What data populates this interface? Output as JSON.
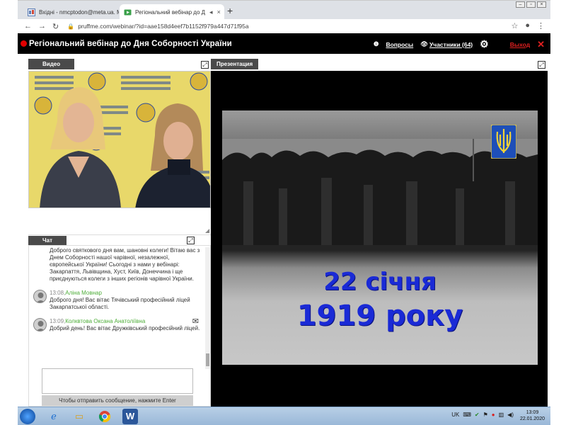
{
  "browser": {
    "tabs": [
      {
        "label": "Вхідні - nmcptodon@meta.ua. M",
        "active": false
      },
      {
        "label": "Регіональний вебінар до Д",
        "active": true
      }
    ],
    "window_controls": [
      "minimize",
      "restore",
      "close"
    ],
    "url": "pruffme.com/webinar/?id=aae158d4eef7b1152f979a447d71f95a"
  },
  "webinar": {
    "title": "Регіональний вебінар до Дня Соборності України",
    "questions_label": "Вопросы",
    "participants_label": "Участники (64)",
    "exit_label": "Выход",
    "accent_color": "#e02020"
  },
  "video": {
    "tab_label": "Видео"
  },
  "presentation": {
    "tab_label": "Презентация",
    "slide_line1": "22 січня",
    "slide_line2": "1919 року",
    "slide_text_color": "#1a2ad6"
  },
  "chat": {
    "tab_label": "Чат",
    "intro_text": "Доброго святкового дня вам, шановні колеги! Вітаю вас з Днем Соборності нашої чарівної, незалежної, європейської України! Сьогодні з нами у вебінарі: Закарпаття, Львівщина, Хуст, Київ, Донеччина і ще приєднуються колеги з інших регіонів чарівної України.",
    "messages": [
      {
        "time": "13:08,",
        "author": "Аліна Мовнар",
        "text": "Доброго дня! Вас вітає Тячівський професійний ліцей Закарпатської області."
      },
      {
        "time": "13:09,",
        "author": "Колквтова Оксана Анатоліївна",
        "text": "Добрий день! Вас вітає Дружківський професійний ліцей."
      }
    ],
    "send_hint": "Чтобы отправить сообщение, нажмите Enter"
  },
  "taskbar": {
    "language": "UK",
    "time": "13:09",
    "date": "22.01.2020",
    "pinned": [
      "windows-explorer-icon",
      "internet-explorer-icon",
      "file-manager-icon",
      "chrome-icon",
      "word-icon"
    ]
  }
}
